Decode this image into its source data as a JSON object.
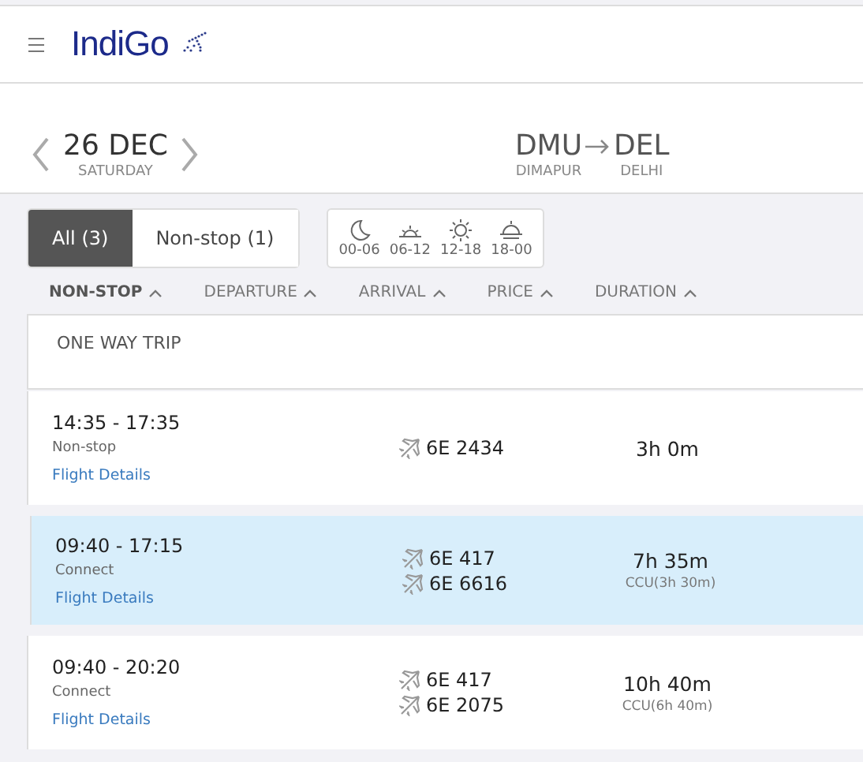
{
  "header": {
    "logo": "IndiGo"
  },
  "date": {
    "day": "26 DEC",
    "weekday": "SATURDAY"
  },
  "route": {
    "from": {
      "code": "DMU",
      "city": "DIMAPUR"
    },
    "to": {
      "code": "DEL",
      "city": "DELHI"
    }
  },
  "stop_filters": [
    {
      "label": "All (3)",
      "selected": true
    },
    {
      "label": "Non-stop (1)",
      "selected": false
    }
  ],
  "time_filters": [
    {
      "kind": "night",
      "label": "00-06"
    },
    {
      "kind": "sunrise",
      "label": "06-12"
    },
    {
      "kind": "day",
      "label": "12-18"
    },
    {
      "kind": "sunset",
      "label": "18-00"
    }
  ],
  "sort_columns": [
    {
      "label": "NON-STOP",
      "selected": true
    },
    {
      "label": "DEPARTURE",
      "selected": false
    },
    {
      "label": "ARRIVAL",
      "selected": false
    },
    {
      "label": "PRICE",
      "selected": false
    },
    {
      "label": "DURATION",
      "selected": false
    }
  ],
  "trip_heading": "ONE WAY TRIP",
  "flights": [
    {
      "times": "14:35 - 17:35",
      "type": "Non-stop",
      "details_link": "Flight Details",
      "numbers": [
        "6E 2434"
      ],
      "duration": "3h 0m",
      "selected": false
    },
    {
      "times": "09:40 - 17:15",
      "type": "Connect",
      "details_link": "Flight Details",
      "numbers": [
        "6E 417",
        "6E 6616"
      ],
      "duration": "7h 35m",
      "layover": "CCU(3h 30m)",
      "selected": true
    },
    {
      "times": "09:40 - 20:20",
      "type": "Connect",
      "details_link": "Flight Details",
      "numbers": [
        "6E 417",
        "6E 2075"
      ],
      "duration": "10h 40m",
      "layover": "CCU(6h 40m)",
      "selected": false
    }
  ]
}
